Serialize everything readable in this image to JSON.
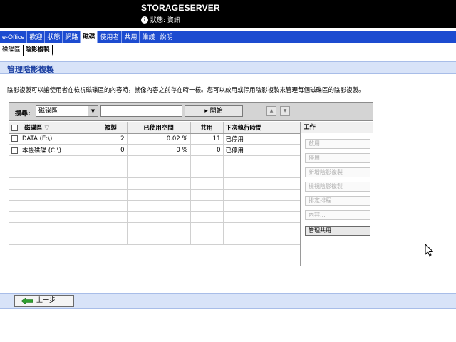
{
  "header": {
    "server_name": "STORAGESERVER",
    "status": "狀態: 資訊"
  },
  "nav": {
    "items": [
      {
        "label": "e-Office",
        "active": false
      },
      {
        "label": "歡迎",
        "active": false
      },
      {
        "label": "狀態",
        "active": false
      },
      {
        "label": "網路",
        "active": false
      },
      {
        "label": "磁碟",
        "active": true
      },
      {
        "label": "使用者",
        "active": false
      },
      {
        "label": "共用",
        "active": false
      },
      {
        "label": "維護",
        "active": false
      },
      {
        "label": "說明",
        "active": false
      }
    ]
  },
  "subtabs": [
    {
      "label": "磁碟區",
      "active": false
    },
    {
      "label": "陰影複製",
      "active": true
    }
  ],
  "page": {
    "title": "管理陰影複製",
    "description": "陰影複製可以讓使用者在檢視磁碟區的內容時，就像內容之前存在時一樣。您可以啟用或停用陰影複製來管理每個磁碟區的陰影複製。"
  },
  "toolbar": {
    "search_label": "搜尋:",
    "scope_value": "磁碟區",
    "search_value": "",
    "start_label": "▸ 開始"
  },
  "table": {
    "columns": [
      "磁碟區",
      "複製",
      "已使用空間",
      "共用",
      "下次執行時間"
    ],
    "sort_indicator": "▽",
    "rows": [
      {
        "volume": "DATA (E:\\)",
        "copies": "2",
        "used": "0.02 %",
        "shares": "11",
        "next_run": "已停用"
      },
      {
        "volume": "本機磁碟 (C:\\)",
        "copies": "0",
        "used": "0 %",
        "shares": "0",
        "next_run": "已停用"
      }
    ],
    "empty_rows": 8
  },
  "actions": {
    "header": "工作",
    "buttons": [
      {
        "label": "啟用",
        "enabled": false
      },
      {
        "label": "停用",
        "enabled": false
      },
      {
        "label": "新增陰影複製",
        "enabled": false
      },
      {
        "label": "檢視陰影複製",
        "enabled": false
      },
      {
        "label": "排定排程...",
        "enabled": false
      },
      {
        "label": "內容...",
        "enabled": false
      },
      {
        "label": "管理共用",
        "enabled": true
      }
    ]
  },
  "footer": {
    "back_label": "上一步"
  }
}
